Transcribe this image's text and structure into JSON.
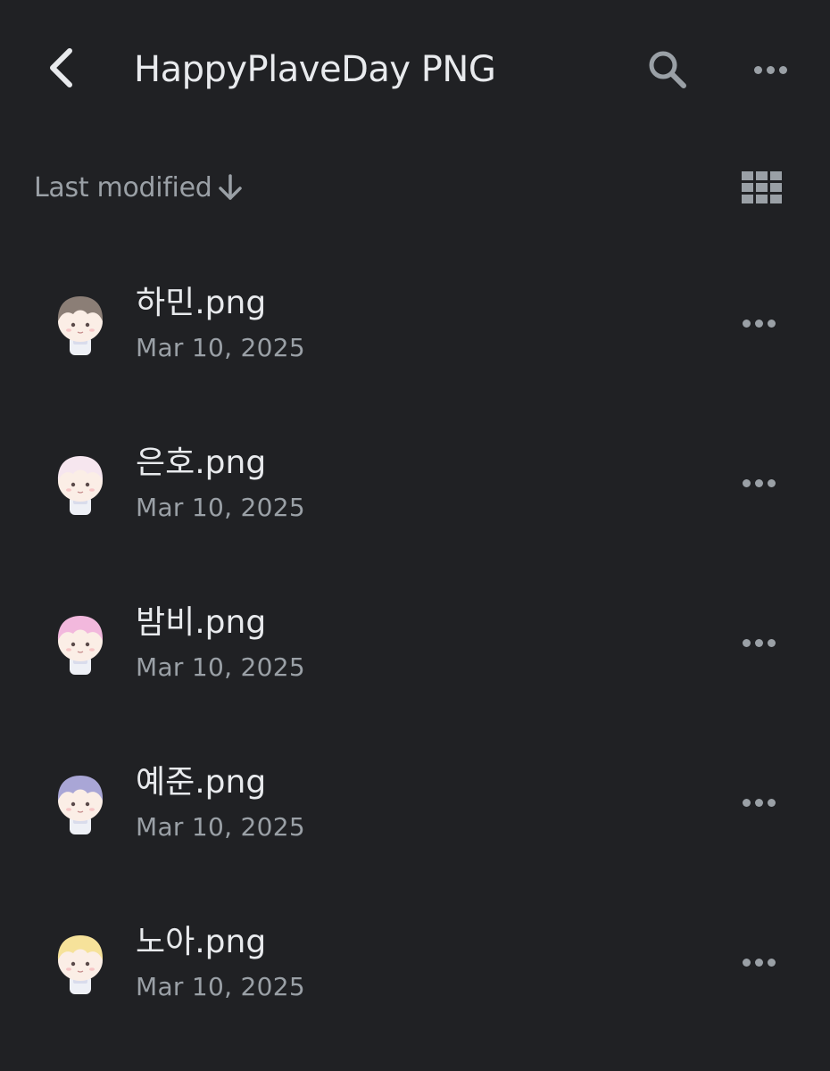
{
  "header": {
    "title": "HappyPlaveDay PNG",
    "back_icon": "chevron-left-icon",
    "search_icon": "search-icon",
    "more_icon": "more-horizontal-icon"
  },
  "sort": {
    "label": "Last modified",
    "direction_icon": "arrow-down-icon",
    "view_icon": "grid-view-icon"
  },
  "files": [
    {
      "name": "하민.png",
      "date": "Mar 10, 2025",
      "hair_color": "#8b7e76"
    },
    {
      "name": "은호.png",
      "date": "Mar 10, 2025",
      "hair_color": "#f6e6ef"
    },
    {
      "name": "밤비.png",
      "date": "Mar 10, 2025",
      "hair_color": "#f2b8dd"
    },
    {
      "name": "예준.png",
      "date": "Mar 10, 2025",
      "hair_color": "#a9a6d6"
    },
    {
      "name": "노아.png",
      "date": "Mar 10, 2025",
      "hair_color": "#f6e29a"
    }
  ],
  "colors": {
    "background": "#202124",
    "primary_text": "#e8eaed",
    "secondary_text": "#9aa0a6"
  }
}
